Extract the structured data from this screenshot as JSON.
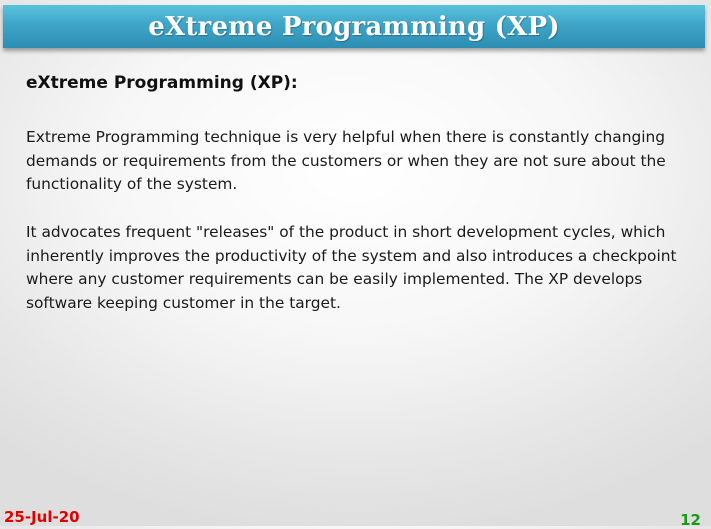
{
  "slide": {
    "title": "eXtreme Programming (XP)",
    "heading": "eXtreme Programming (XP):",
    "paragraphs": [
      "Extreme Programming technique is very helpful when there is constantly changing demands or requirements from the customers or when they are not sure about the functionality of the system.",
      "It advocates frequent \"releases\" of the product in short development cycles, which inherently improves the productivity of the system and also introduces a checkpoint where any customer requirements can be easily implemented. The XP develops software keeping customer in the target."
    ],
    "footer": {
      "date": "25-Jul-20",
      "page_number": "12"
    }
  },
  "colors": {
    "title_bar": "#3fa5c8",
    "date": "#e00000",
    "page_number": "#1a9a1a"
  }
}
